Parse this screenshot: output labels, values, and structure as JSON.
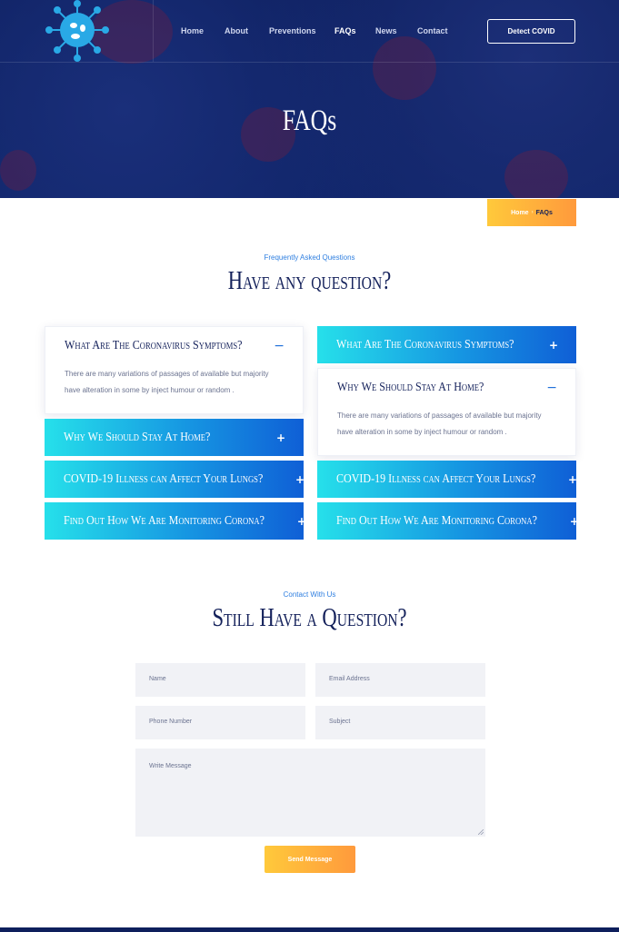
{
  "nav": {
    "items": [
      {
        "label": "Home",
        "active": false
      },
      {
        "label": "About",
        "active": false
      },
      {
        "label": "Preventions",
        "active": false
      },
      {
        "label": "FAQs",
        "active": true
      },
      {
        "label": "News",
        "active": false
      },
      {
        "label": "Contact",
        "active": false
      }
    ],
    "cta_label": "Detect COVID"
  },
  "hero": {
    "title": "FAQs",
    "breadcrumb": {
      "home": "Home",
      "separator": "›",
      "current": "FAQs"
    }
  },
  "faq_section": {
    "eyebrow": "Frequently Asked Questions",
    "title": "Have any question?",
    "left_column": [
      {
        "question": "What Are The Coronavirus Symptoms?",
        "open": true,
        "toggle": "−",
        "answer": "There are many variations of passages of available but majority have alteration in some by inject humour or random ."
      },
      {
        "question": "Why We Should Stay At Home?",
        "open": false,
        "toggle": "+"
      },
      {
        "question": "COVID-19 Illness can Affect Your Lungs?",
        "open": false,
        "toggle": "+"
      },
      {
        "question": "Find Out How We Are Monitoring Corona?",
        "open": false,
        "toggle": "+"
      }
    ],
    "right_column": [
      {
        "question": "What Are The Coronavirus Symptoms?",
        "open": false,
        "toggle": "+"
      },
      {
        "question": "Why We Should Stay At Home?",
        "open": true,
        "toggle": "−",
        "answer": "There are many variations of passages of available but majority have alteration in some by inject humour or random ."
      },
      {
        "question": "COVID-19 Illness can Affect Your Lungs?",
        "open": false,
        "toggle": "+"
      },
      {
        "question": "Find Out How We Are Monitoring Corona?",
        "open": false,
        "toggle": "+"
      }
    ]
  },
  "contact_section": {
    "eyebrow": "Contact With Us",
    "title": "Still Have a Question?",
    "form": {
      "name_placeholder": "Name",
      "email_placeholder": "Email Address",
      "phone_placeholder": "Phone Number",
      "subject_placeholder": "Subject",
      "message_placeholder": "Write Message",
      "submit_label": "Send Message"
    }
  },
  "colors": {
    "navy": "#0d1f5e",
    "heading": "#13205a",
    "accent_blue": "#2f7fe0",
    "gradient_cyan": "#26e0ea",
    "gradient_blue": "#0f5fd6",
    "orange_start": "#ffc93b",
    "orange_end": "#ff9a3c"
  }
}
